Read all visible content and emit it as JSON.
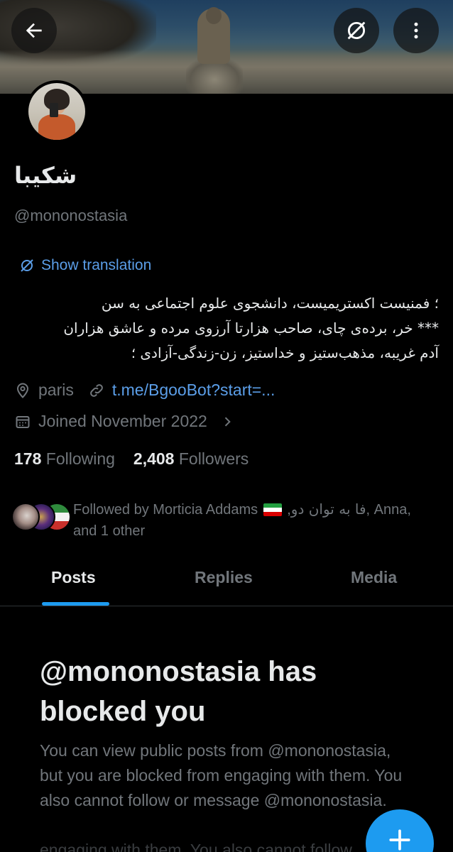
{
  "profile": {
    "display_name": "شکیبا",
    "handle": "@mononostasia",
    "show_translation": "Show translation",
    "bio_lines": [
      "؛ فمنیست اکستریمیست، دانشجوی علوم اجتماعی به سن",
      "*** خر، برده‌ی چای، صاحب هزارتا آرزوی مرده و عاشق هزاران",
      "آدم غریبه، مذهب‌ستیز و خداستیز، زن-زندگی-آزادی ؛"
    ],
    "location": "paris",
    "link": "t.me/BgooBot?start=...",
    "joined": "Joined November 2022",
    "following_count": "178",
    "following_label": "Following",
    "followers_count": "2,408",
    "followers_label": "Followers",
    "followed_by_prefix": "Followed by Morticia Addams",
    "followed_by_rtl_name": "فا به توان دو",
    "followed_by_suffix": ", Anna,",
    "followed_by_line2": "and 1 other"
  },
  "tabs": [
    {
      "label": "Posts",
      "active": true
    },
    {
      "label": "Replies",
      "active": false
    },
    {
      "label": "Media",
      "active": false
    }
  ],
  "blocked": {
    "title": "@mononostasia has blocked you",
    "body": "You can view public posts from @mononostasia, but you are blocked from engaging with them. You also cannot follow or message @mononostasia.",
    "ghost": "engaging with them. You also cannot follow"
  },
  "icons": {
    "back": "arrow-left-icon",
    "translate": "translate-icon",
    "more": "more-vertical-icon",
    "location": "location-pin-icon",
    "link": "link-icon",
    "calendar": "calendar-icon",
    "chevron": "chevron-right-icon",
    "compose": "plus-icon"
  },
  "colors": {
    "accent": "#1d9bf0",
    "link": "#5b9ee8",
    "muted": "#71767b",
    "text": "#e7e9ea",
    "background": "#000000"
  }
}
